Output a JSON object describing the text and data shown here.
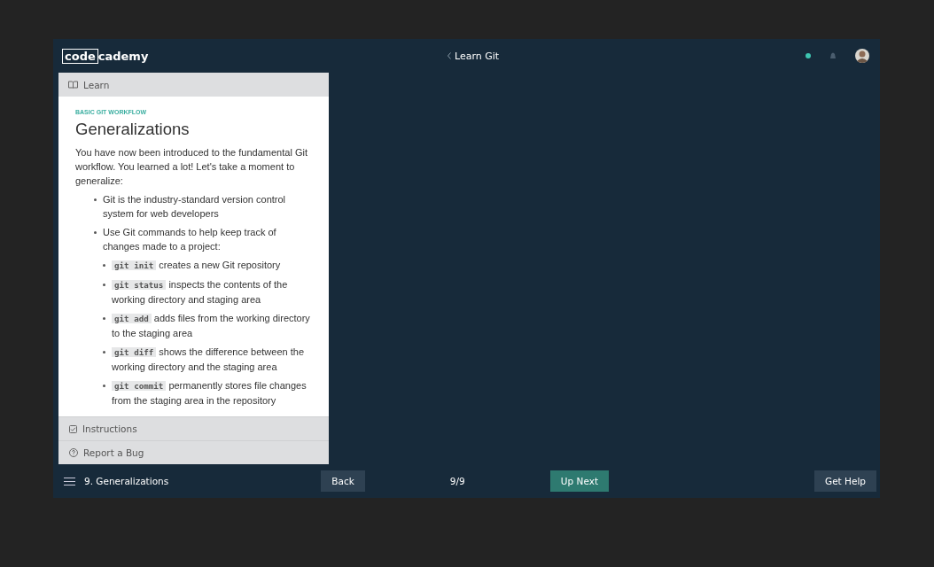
{
  "header": {
    "logo": {
      "boxed": "code",
      "rest": "cademy"
    },
    "breadcrumb": "Learn Git"
  },
  "panel": {
    "tab": "Learn",
    "eyebrow": "BASIC GIT WORKFLOW",
    "title": "Generalizations",
    "intro": "You have now been introduced to the fundamental Git workflow. You learned a lot! Let's take a moment to generalize:",
    "bullets": [
      {
        "text": "Git is the industry-standard version control system for web developers"
      },
      {
        "text": "Use Git commands to help keep track of changes made to a project:",
        "children": [
          {
            "code": "git init",
            "text": "creates a new Git repository"
          },
          {
            "code": "git status",
            "text": "inspects the contents of the working directory and staging area"
          },
          {
            "code": "git add",
            "text": "adds files from the working directory to the staging area"
          },
          {
            "code": "git diff",
            "text": "shows the difference between the working directory and the staging area"
          },
          {
            "code": "git commit",
            "text": "permanently stores file changes from the staging area in the repository"
          }
        ]
      }
    ],
    "links": [
      {
        "kind": "checkbox",
        "label": "Instructions"
      },
      {
        "kind": "help",
        "label": "Report a Bug"
      }
    ]
  },
  "footer": {
    "lesson": "9. Generalizations",
    "back": "Back",
    "progress": "9/9",
    "next": "Up Next",
    "help": "Get Help"
  }
}
